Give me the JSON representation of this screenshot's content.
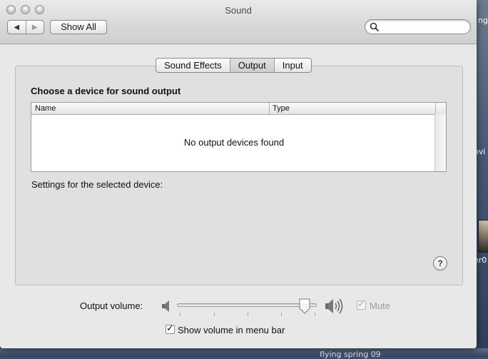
{
  "window": {
    "title": "Sound"
  },
  "toolbar": {
    "back_glyph": "◀",
    "forward_glyph": "▶",
    "show_all": "Show All",
    "search": {
      "value": "",
      "placeholder": ""
    }
  },
  "tabs": [
    {
      "label": "Sound Effects",
      "selected": false
    },
    {
      "label": "Output",
      "selected": true
    },
    {
      "label": "Input",
      "selected": false
    }
  ],
  "output": {
    "heading": "Choose a device for sound output",
    "columns": [
      "Name",
      "Type"
    ],
    "empty_message": "No output devices found",
    "settings_label": "Settings for the selected device:"
  },
  "help": {
    "glyph": "?"
  },
  "volume": {
    "label": "Output volume:",
    "level": 0.95,
    "mute_label": "Mute",
    "mute_checked": true,
    "mute_enabled": false,
    "menubar_label": "Show volume in menu bar",
    "menubar_checked": true,
    "check_glyph": "✓"
  },
  "desktop": {
    "labels": [
      "ng",
      "ovi",
      "er0",
      "flying spring 09"
    ]
  },
  "icons": {
    "traffic_lights": "traffic-light-icon",
    "search": "magnifier-icon",
    "volume_low": "speaker-low-icon",
    "volume_high": "speaker-high-icon",
    "help": "help-icon"
  }
}
